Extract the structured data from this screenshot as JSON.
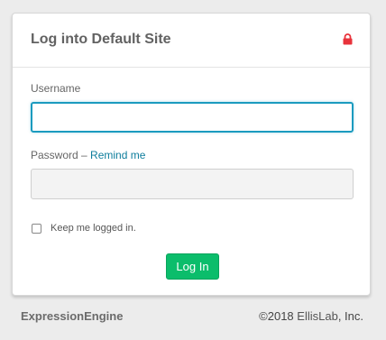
{
  "login": {
    "title": "Log into Default Site",
    "lock_icon": "lock-icon",
    "lock_color": "#e8333b",
    "username_label": "Username",
    "username_value": "",
    "password_label": "Password",
    "password_separator": " – ",
    "remind_link": "Remind me",
    "password_value": "",
    "remember_label": "Keep me logged in.",
    "remember_checked": false,
    "submit_label": "Log In",
    "submit_color": "#0bbd6b"
  },
  "footer": {
    "brand": "ExpressionEngine",
    "copyright_prefix": "©2018 ",
    "company": "EllisLab",
    "copyright_suffix": ", Inc."
  }
}
